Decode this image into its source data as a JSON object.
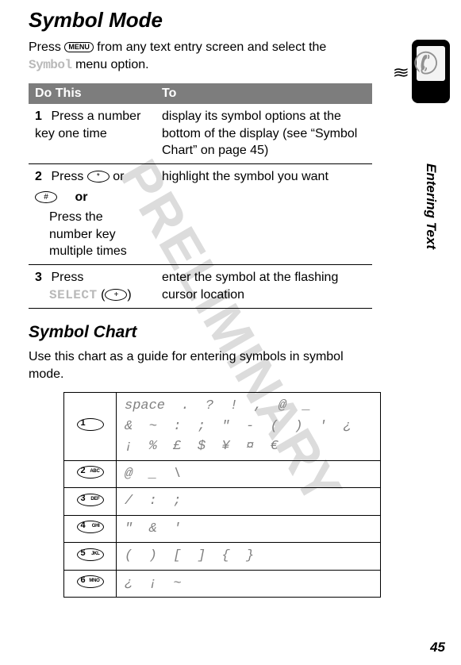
{
  "watermark": "PRELIMINARY",
  "title": "Symbol Mode",
  "intro": {
    "part1": "Press ",
    "menuLabel": "MENU",
    "part2": " from any text entry screen and select the ",
    "symbolWord": "Symbol",
    "part3": " menu option."
  },
  "tableHeader": {
    "left": "Do This",
    "right": "To"
  },
  "steps": [
    {
      "num": "1",
      "left_main": "Press a number key one time",
      "right": "display its symbol options at the bottom of the display (see “Symbol Chart” on page 45)"
    },
    {
      "num": "2",
      "left_prefix": "Press ",
      "key1": "*",
      "mid": " or ",
      "key2": "#",
      "or": "or",
      "left_alt": "Press the number key multiple times",
      "right": "highlight the symbol you want"
    },
    {
      "num": "3",
      "left_prefix": "Press",
      "select_word": "SELECT",
      "paren_open": " (",
      "softkey": "+",
      "paren_close": ")",
      "right": "enter the symbol at the flashing cursor location"
    }
  ],
  "subtitle": "Symbol Chart",
  "chart_intro": "Use this chart as a guide for entering symbols in symbol mode.",
  "chart": [
    {
      "num": "1",
      "lbl": "",
      "symbols": "space . ? ! , @ _\n& ~ : ; \" - ( ) ' ¿\n¡ % £ $ ¥ ¤ €"
    },
    {
      "num": "2",
      "lbl": "ABC",
      "symbols": "@ _ \\"
    },
    {
      "num": "3",
      "lbl": "DEF",
      "symbols": "/ : ;"
    },
    {
      "num": "4",
      "lbl": "GHI",
      "symbols": "\" & '"
    },
    {
      "num": "5",
      "lbl": "JKL",
      "symbols": "( ) [ ] { }"
    },
    {
      "num": "6",
      "lbl": "MNO",
      "symbols": "¿ ¡ ~"
    }
  ],
  "side_label": "Entering Text",
  "page_number": "45"
}
